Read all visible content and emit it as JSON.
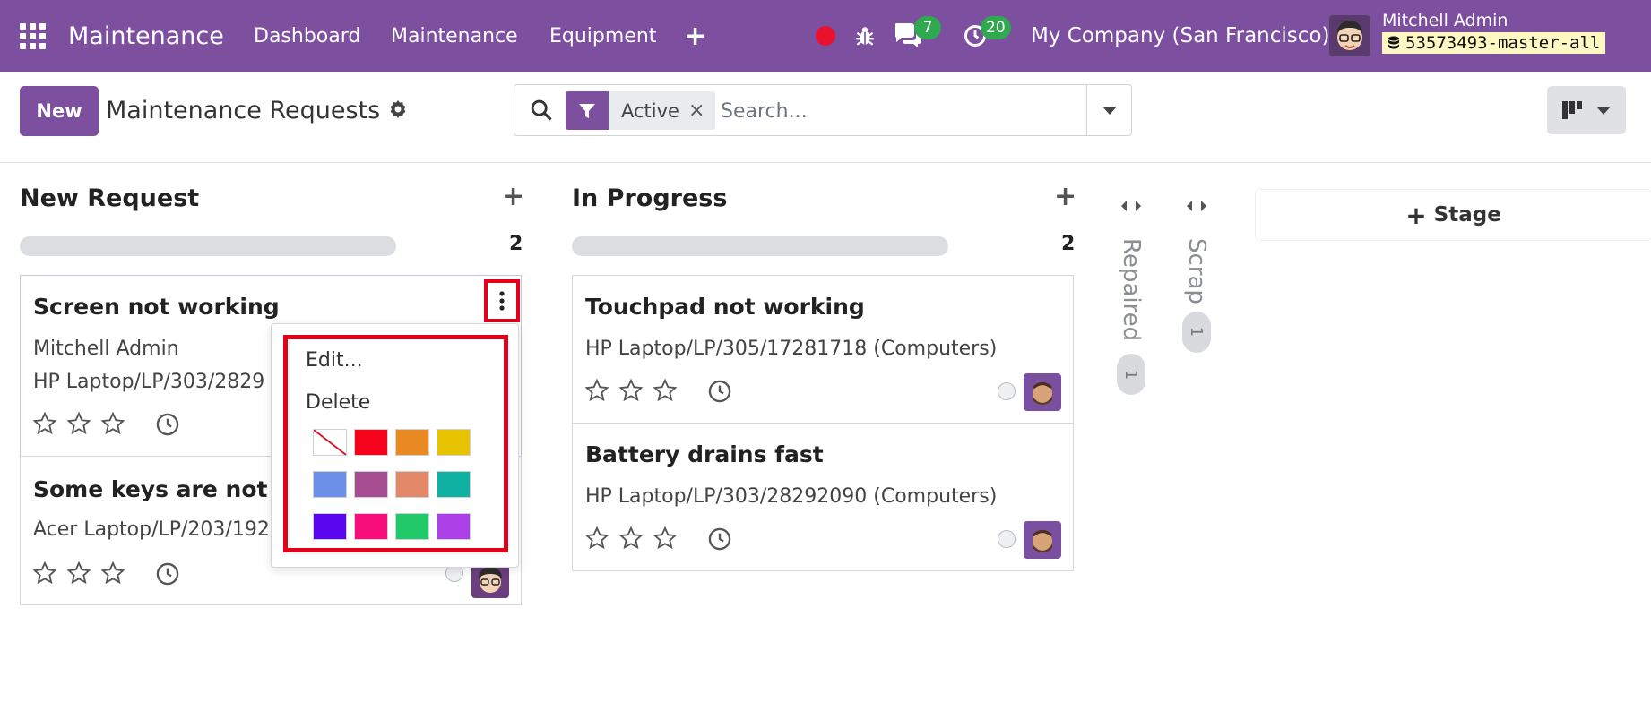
{
  "navbar": {
    "app_name": "Maintenance",
    "menu": [
      "Dashboard",
      "Maintenance",
      "Equipment"
    ],
    "chat_badge": "7",
    "activity_badge": "20",
    "company": "My Company (San Francisco)",
    "user_name": "Mitchell Admin",
    "database": "53573493-master-all"
  },
  "control": {
    "new_label": "New",
    "title": "Maintenance Requests",
    "facet_label": "Active",
    "facet_close": "×",
    "search_placeholder": "Search..."
  },
  "columns": [
    {
      "title": "New Request",
      "count": "2",
      "cards": [
        {
          "title": "Screen not working",
          "line1": "Mitchell Admin",
          "line2": "HP Laptop/LP/303/2829"
        },
        {
          "title": "Some keys are not wo",
          "line1": "Acer Laptop/LP/203/192"
        }
      ]
    },
    {
      "title": "In Progress",
      "count": "2",
      "cards": [
        {
          "title": "Touchpad not working",
          "line1": "HP Laptop/LP/305/17281718 (Computers)"
        },
        {
          "title": "Battery drains fast",
          "line1": "HP Laptop/LP/303/28292090 (Computers)"
        }
      ]
    }
  ],
  "folded_columns": [
    {
      "title": "Repaired",
      "count": "1"
    },
    {
      "title": "Scrap",
      "count": "1"
    }
  ],
  "add_stage_label": "Stage",
  "dropdown": {
    "edit_label": "Edit...",
    "delete_label": "Delete",
    "colors": [
      "#ffffff",
      "#f5021b",
      "#e88922",
      "#e8c300",
      "#6c8fe7",
      "#a64d91",
      "#e4886a",
      "#0fb1a3",
      "#5a06ee",
      "#f80f7c",
      "#22c968",
      "#ab40e6"
    ]
  },
  "colors": {
    "brand": "#7c4f9f",
    "highlight": "#e3001b",
    "badge": "#2fa84f"
  }
}
